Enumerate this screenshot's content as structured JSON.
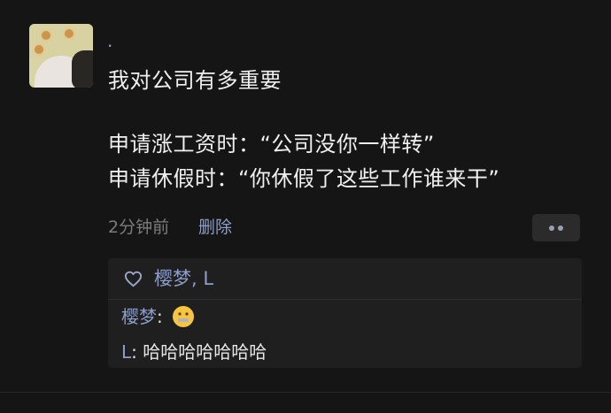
{
  "post": {
    "author": ".",
    "lines": [
      "我对公司有多重要",
      "申请涨工资时：“公司没你一样转”",
      "申请休假时：“你休假了这些工作谁来干”"
    ],
    "time": "2分钟前",
    "delete_label": "删除"
  },
  "likes": {
    "icon": "heart-outline-icon",
    "names": "樱梦, L"
  },
  "comments": [
    {
      "author": "樱梦",
      "separator": ": ",
      "text": "",
      "emoji": "zipper-mouth-face-emoji"
    },
    {
      "author": "L",
      "separator": ": ",
      "text": "哈哈哈哈哈哈哈"
    }
  ]
}
